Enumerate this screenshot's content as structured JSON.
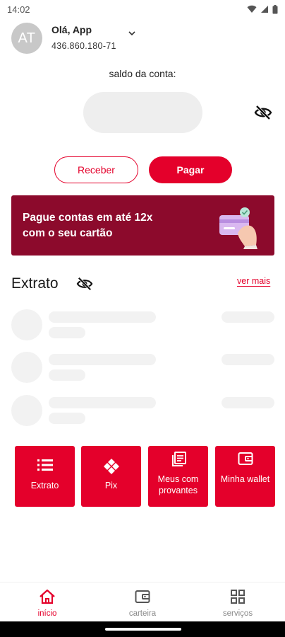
{
  "status_bar": {
    "time": "14:02"
  },
  "header": {
    "avatar_initials": "AT",
    "greeting": "Olá, App",
    "account_number": "436.860.180-71"
  },
  "balance": {
    "label": "saldo da conta:",
    "visibility": "hidden"
  },
  "actions": {
    "receive_label": "Receber",
    "pay_label": "Pagar"
  },
  "banner": {
    "text": "Pague contas em até 12x com o seu cartão",
    "background": "#8c0a2c"
  },
  "statement": {
    "title": "Extrato",
    "see_more_label": "ver mais",
    "loading_placeholders": 3
  },
  "quick_actions": [
    {
      "label": "Extrato",
      "icon": "list-icon"
    },
    {
      "label": "Pix",
      "icon": "pix-icon"
    },
    {
      "label": "Meus com provantes",
      "icon": "receipts-icon"
    },
    {
      "label": "Minha wallet",
      "icon": "wallet-icon"
    }
  ],
  "bottom_nav": [
    {
      "label": "início",
      "icon": "home-icon",
      "active": true
    },
    {
      "label": "carteira",
      "icon": "wallet-icon",
      "active": false
    },
    {
      "label": "serviços",
      "icon": "grid-icon",
      "active": false
    }
  ],
  "colors": {
    "accent": "#e4002b",
    "skeleton": "#f2f2f2",
    "inactive_nav": "#8a8a8a"
  }
}
